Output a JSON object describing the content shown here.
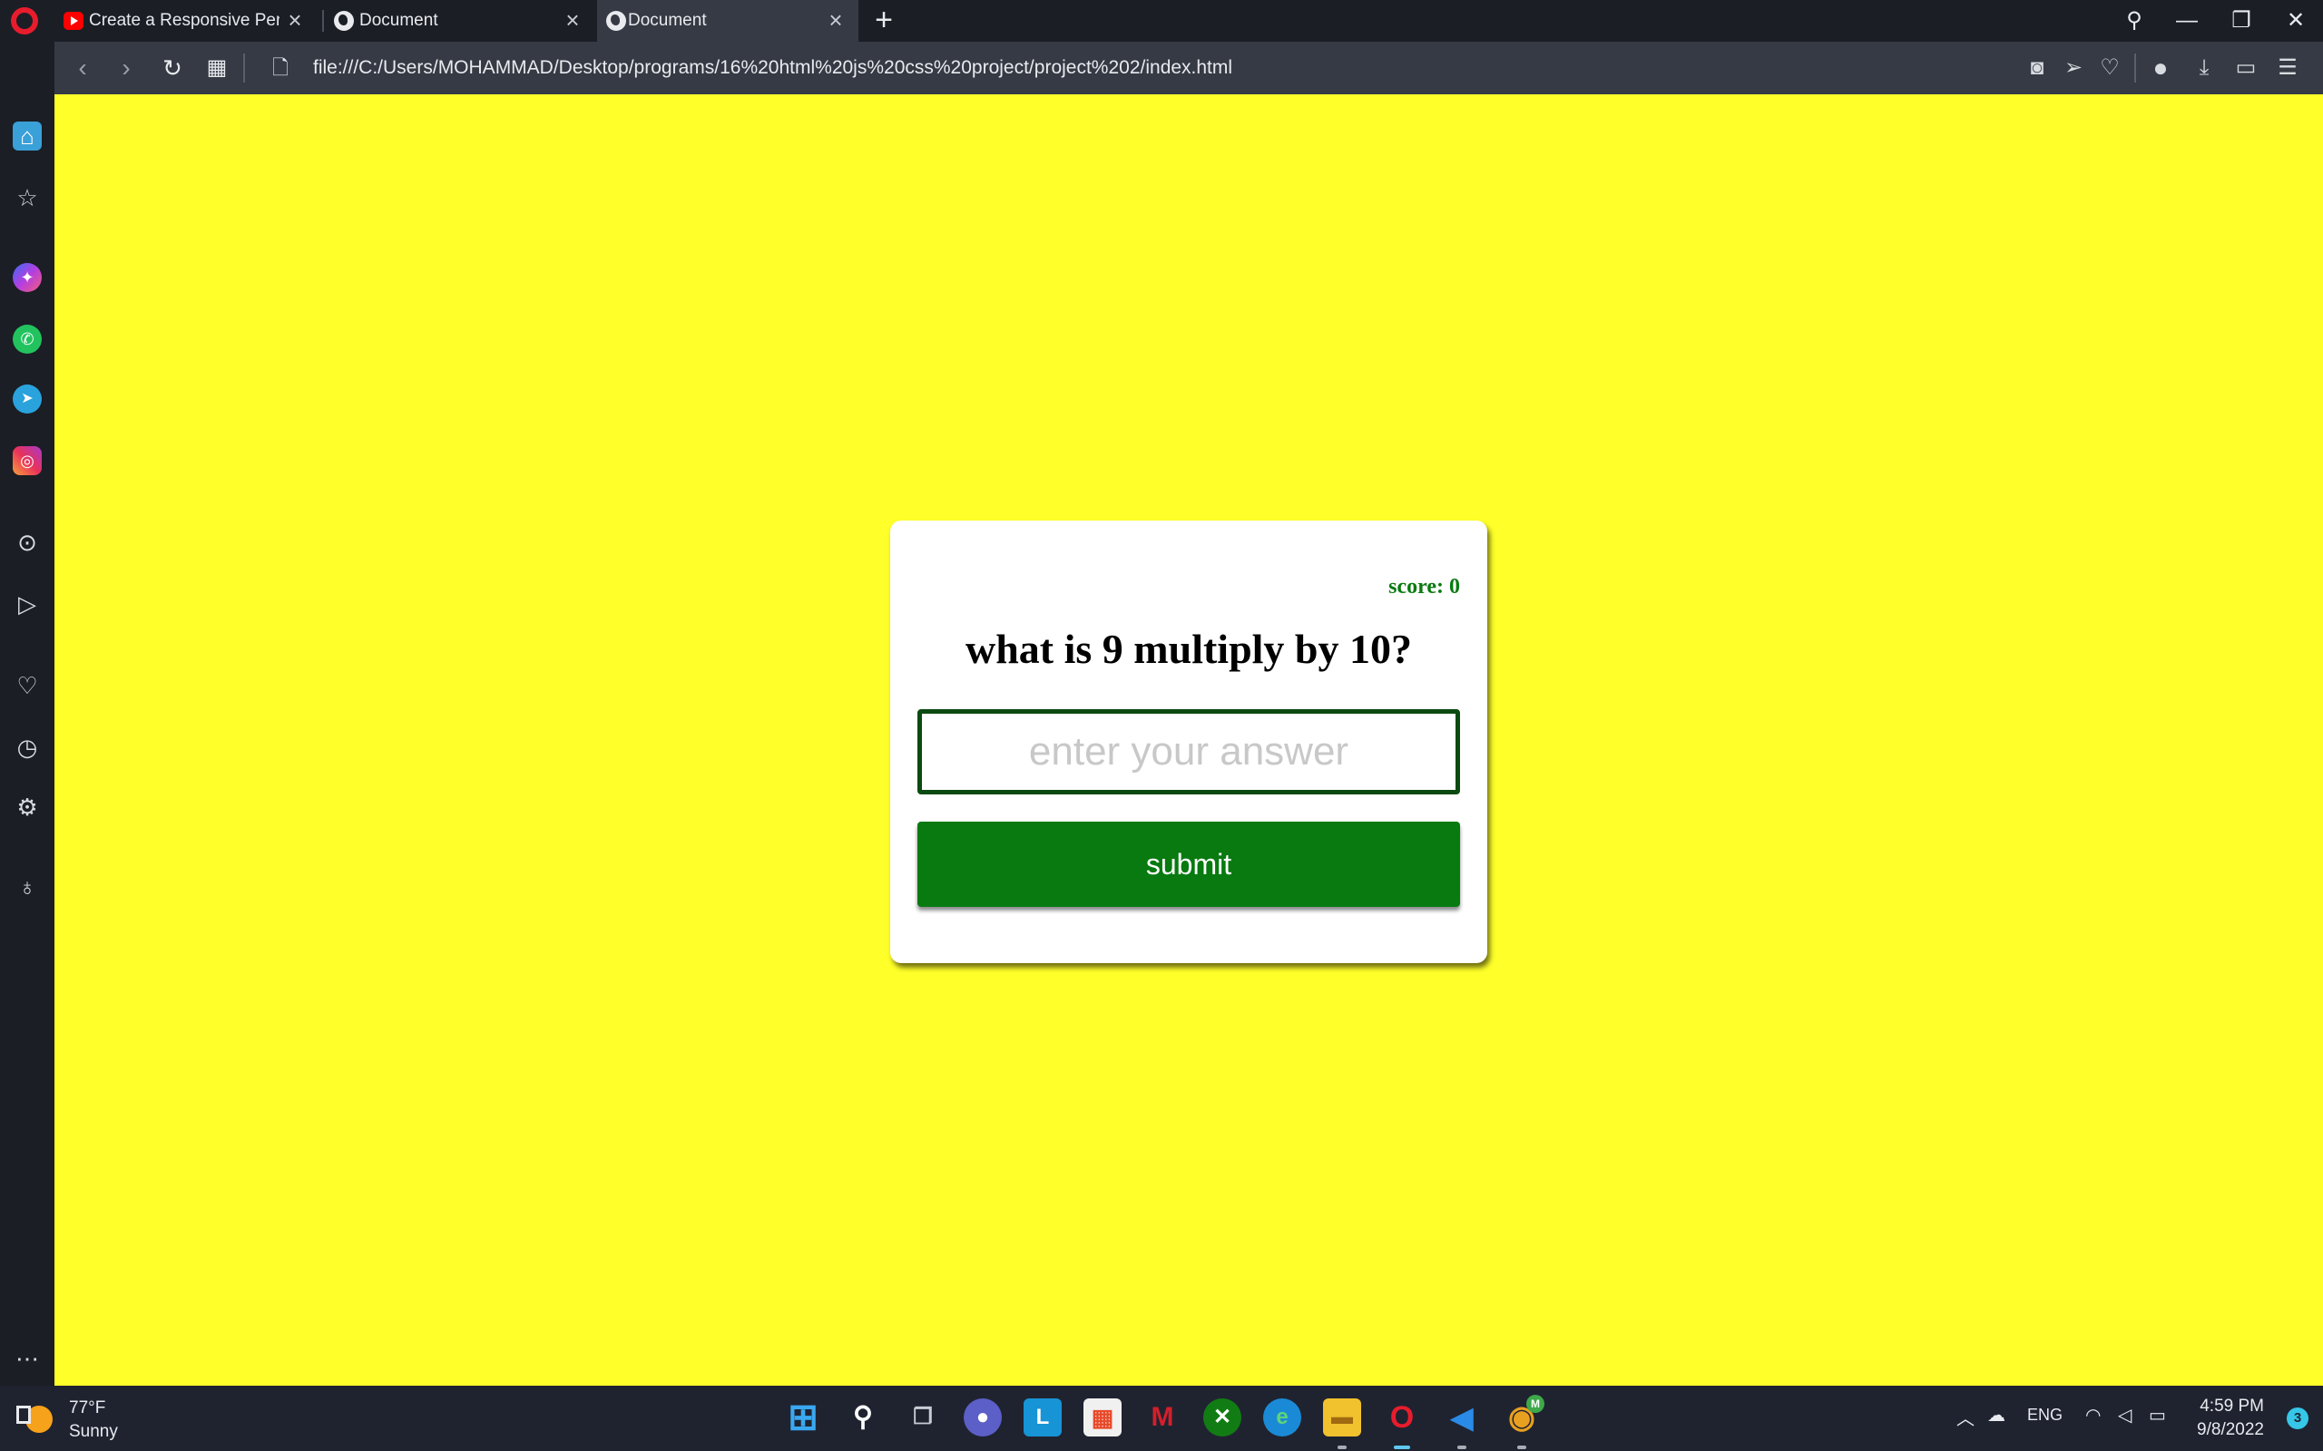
{
  "browser": {
    "tabs": [
      {
        "title": "Create a Responsive Person",
        "favicon": "youtube-icon",
        "active": false
      },
      {
        "title": "Document",
        "favicon": "globe-icon",
        "active": false
      },
      {
        "title": "Document",
        "favicon": "globe-icon",
        "active": true
      }
    ],
    "new_tab": "+",
    "address": "file:///C:/Users/MOHAMMAD/Desktop/programs/16%20html%20js%20css%20project/project%202/index.html"
  },
  "page": {
    "score_label": "score: 0",
    "question": "what is 9 multiply by 10?",
    "answer_placeholder": "enter your answer",
    "answer_value": "",
    "submit_label": "submit",
    "colors": {
      "background": "#ffff2a",
      "accent": "#087a10",
      "card": "#ffffff"
    }
  },
  "taskbar": {
    "weather_temp": "77°F",
    "weather_desc": "Sunny",
    "language": "ENG",
    "time": "4:59 PM",
    "date": "9/8/2022",
    "notification_count": "3",
    "chrome_badge": "M"
  }
}
